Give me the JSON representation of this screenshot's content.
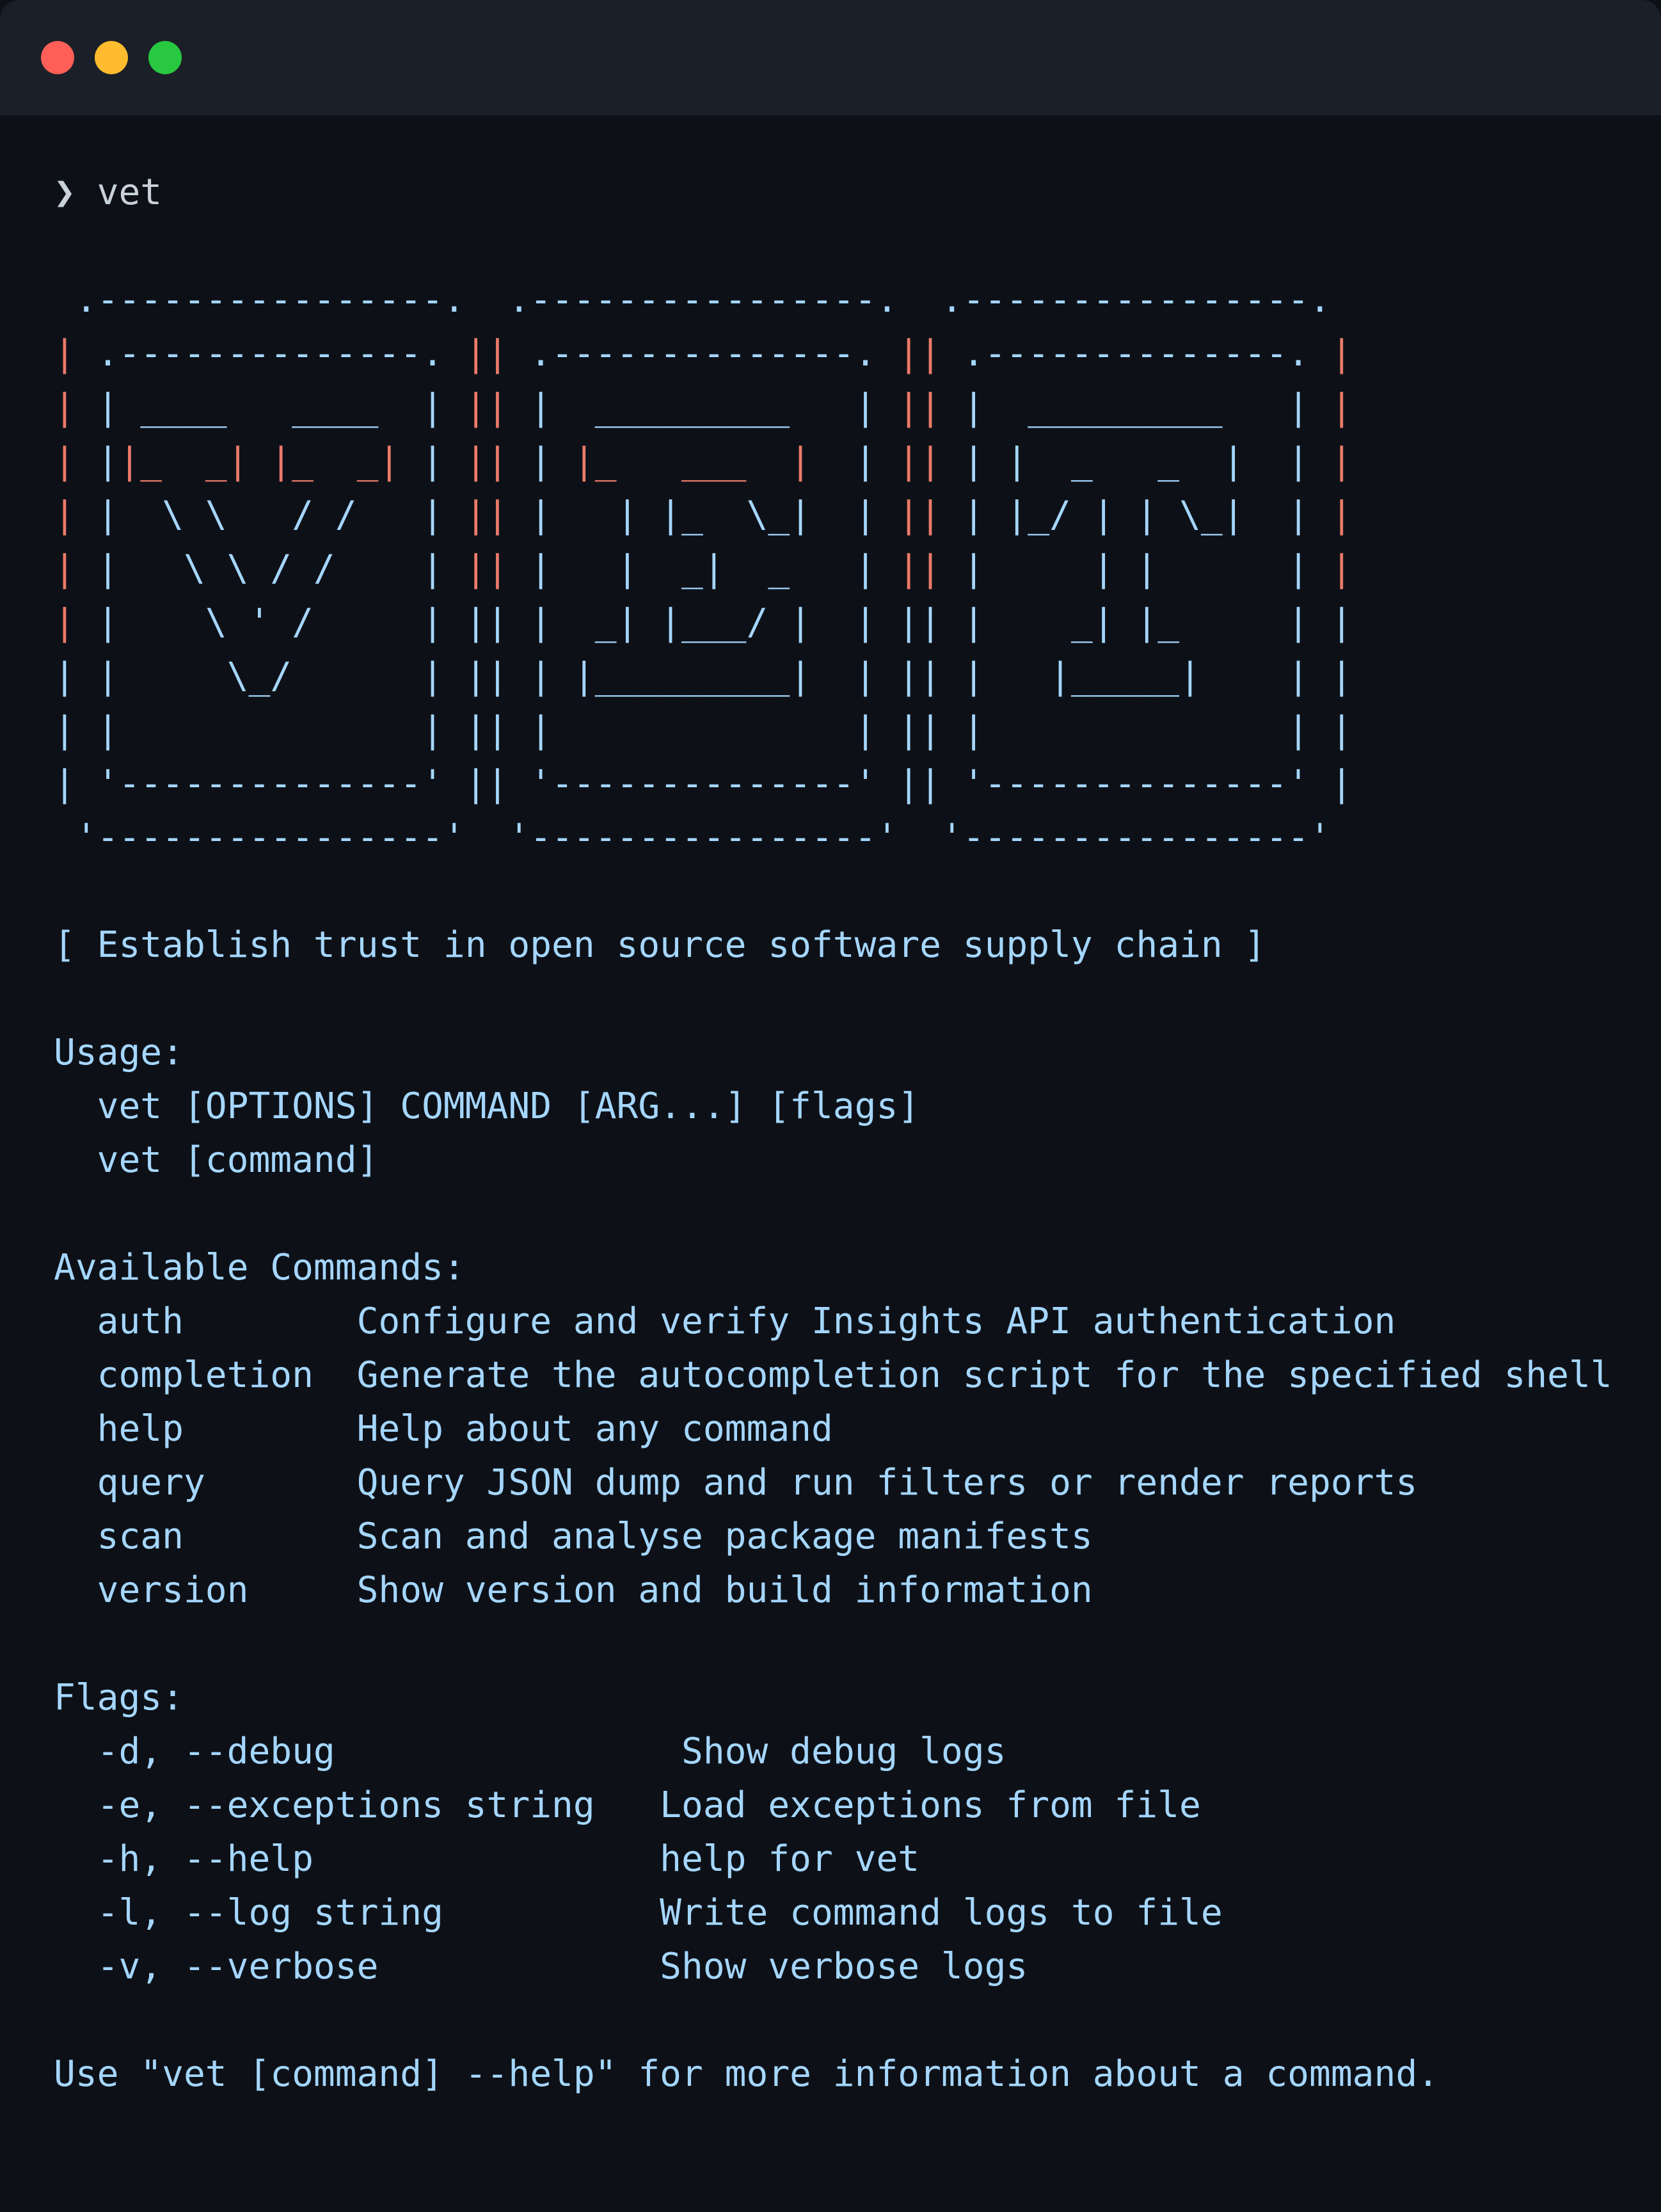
{
  "window": {
    "controls": [
      "close-button",
      "minimize-button",
      "maximize-button"
    ],
    "colors": {
      "close": "#ff5f57",
      "minimize": "#febc2e",
      "maximize": "#28c840"
    }
  },
  "prompt": {
    "symbol": "❯",
    "command": "vet"
  },
  "banner": {
    "lines": [
      [
        [
          " .----------------.  .----------------.  .----------------.",
          "b"
        ]
      ],
      [
        [
          "| ",
          "r"
        ],
        [
          ".--------------. ",
          "b"
        ],
        [
          "|| ",
          "r"
        ],
        [
          ".--------------. ",
          "b"
        ],
        [
          "|| ",
          "r"
        ],
        [
          ".--------------. ",
          "b"
        ],
        [
          "|",
          "r"
        ]
      ],
      [
        [
          "| ",
          "r"
        ],
        [
          "| ____   ____  | ",
          "b"
        ],
        [
          "|| ",
          "r"
        ],
        [
          "|  _________   | ",
          "b"
        ],
        [
          "|| ",
          "r"
        ],
        [
          "|  _________   | ",
          "b"
        ],
        [
          "|",
          "r"
        ]
      ],
      [
        [
          "| ",
          "r"
        ],
        [
          "|",
          "b"
        ],
        [
          "|_  _| |_  _|",
          "r"
        ],
        [
          " | ",
          "b"
        ],
        [
          "|| ",
          "r"
        ],
        [
          "| ",
          "b"
        ],
        [
          "|_   ___  |",
          "r"
        ],
        [
          "  | ",
          "b"
        ],
        [
          "|| ",
          "r"
        ],
        [
          "| |  _   _  |  ",
          "b"
        ],
        [
          "| ",
          "b"
        ],
        [
          "|",
          "r"
        ]
      ],
      [
        [
          "| ",
          "r"
        ],
        [
          "|  \\ \\   / /   | ",
          "b"
        ],
        [
          "|| ",
          "r"
        ],
        [
          "|   | |_  \\_|  | ",
          "b"
        ],
        [
          "|| ",
          "r"
        ],
        [
          "| |_/ | | \\_|  | ",
          "b"
        ],
        [
          "|",
          "r"
        ]
      ],
      [
        [
          "| ",
          "r"
        ],
        [
          "|   \\ \\ / /    | ",
          "b"
        ],
        [
          "|| ",
          "r"
        ],
        [
          "|   |  _|  _   | ",
          "b"
        ],
        [
          "|| ",
          "r"
        ],
        [
          "|     | |      | ",
          "b"
        ],
        [
          "|",
          "r"
        ]
      ],
      [
        [
          "| ",
          "r"
        ],
        [
          "|    \\ ' /     | || |  _| |___/ |  | || |    _| |_     | |",
          "b"
        ]
      ],
      [
        [
          "| |     \\_/      | || | |_________|  | || |   |_____|    | |",
          "b"
        ]
      ],
      [
        [
          "| |              | || |              | || |              | |",
          "b"
        ]
      ],
      [
        [
          "| '--------------' || '--------------' || '--------------' |",
          "b"
        ]
      ],
      [
        [
          " '----------------'  '----------------'  '----------------'",
          "b"
        ]
      ]
    ]
  },
  "tagline": "[ Establish trust in open source software supply chain ]",
  "usage": {
    "heading": "Usage:",
    "lines": [
      "  vet [OPTIONS] COMMAND [ARG...] [flags]",
      "  vet [command]"
    ]
  },
  "commands": {
    "heading": "Available Commands:",
    "items": [
      "  auth        Configure and verify Insights API authentication",
      "  completion  Generate the autocompletion script for the specified shell",
      "  help        Help about any command",
      "  query       Query JSON dump and run filters or render reports",
      "  scan        Scan and analyse package manifests",
      "  version     Show version and build information"
    ]
  },
  "flags": {
    "heading": "Flags:",
    "items": [
      "  -d, --debug                Show debug logs",
      "  -e, --exceptions string   Load exceptions from file",
      "  -h, --help                help for vet",
      "  -l, --log string          Write command logs to file",
      "  -v, --verbose             Show verbose logs"
    ]
  },
  "footer": "Use \"vet [command] --help\" for more information about a command."
}
